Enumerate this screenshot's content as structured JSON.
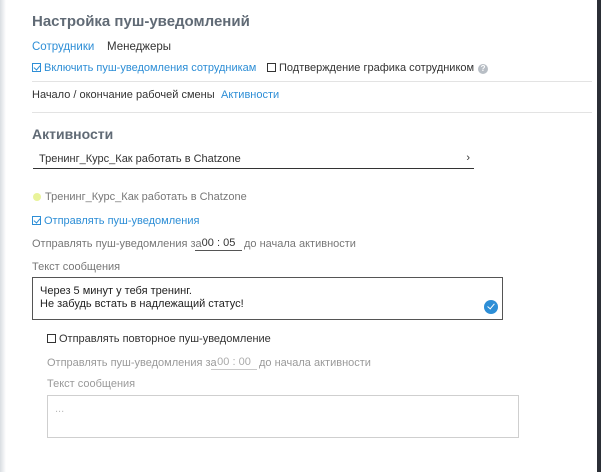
{
  "page": {
    "title": "Настройка пуш-уведомлений",
    "tabs": [
      "Сотрудники",
      "Менеджеры"
    ],
    "enable_push_label": "Включить пуш-уведомления сотрудникам",
    "schedule_confirm_label": "Подтверждение графика сотрудником",
    "help_icon": "?"
  },
  "subnav": {
    "shift_label": "Начало / окончание рабочей смены",
    "activities_label": "Активности"
  },
  "activities": {
    "heading": "Активности",
    "select_value": "Тренинг_Курс_Как работать в Chatzone",
    "select_arrow": "›",
    "activity_name": "Тренинг_Курс_Как работать в Chatzone",
    "send_push_label": "Отправлять пуш-уведомления",
    "send_before_prefix": "Отправлять пуш-уведомления за",
    "send_before_time": "00 : 05",
    "send_before_suffix": "до начала активности",
    "message_label": "Текст сообщения",
    "message_line1": "Через 5 минут у тебя тренинг.",
    "message_line2": "Не забудь встать в надлежащий статус!",
    "repeat_label": "Отправлять повторное пуш-уведомление",
    "repeat_prefix": "Отправлять пуш-уведомления за",
    "repeat_time": "00 : 00",
    "repeat_suffix": "до начала активности",
    "repeat_message_label": "Текст сообщения",
    "repeat_message_placeholder": "..."
  }
}
